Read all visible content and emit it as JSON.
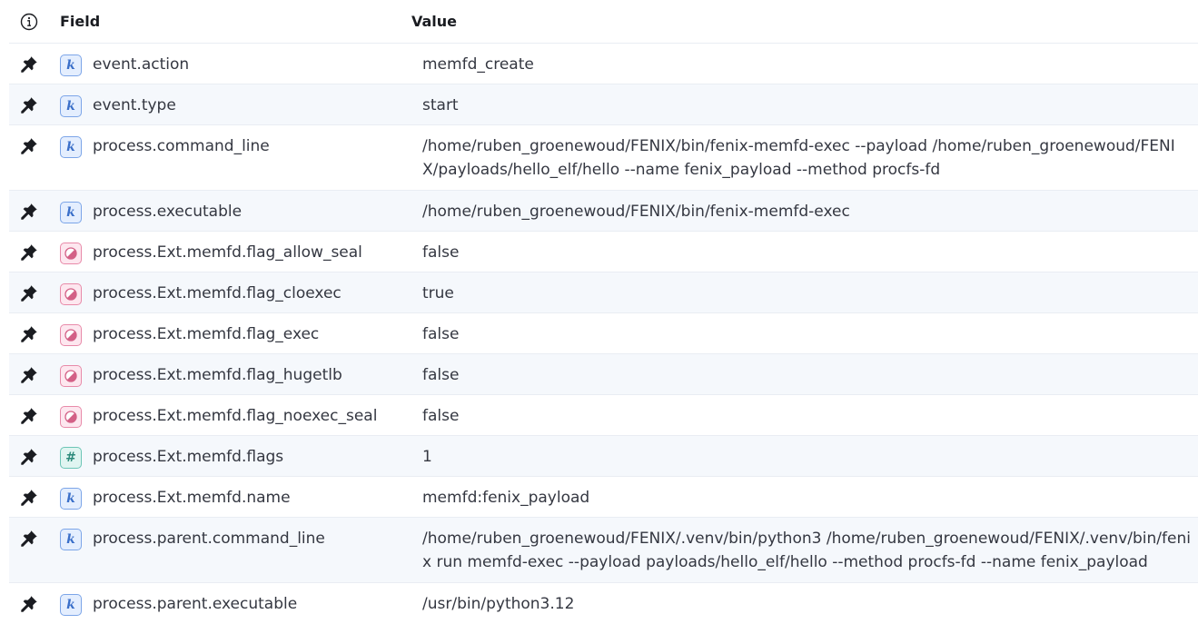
{
  "header": {
    "field_label": "Field",
    "value_label": "Value"
  },
  "icons": {
    "info": "info-icon",
    "pin": "pin-icon",
    "keyword": "keyword-type-icon",
    "number": "number-type-icon",
    "boolean": "boolean-type-icon"
  },
  "colors": {
    "row_alt": "#f5f8fc",
    "border": "#e9edf3",
    "keyword": "#3a6fc9",
    "number": "#2b8a7a",
    "boolean": "#d36086"
  },
  "rows": [
    {
      "type": "keyword",
      "type_glyph": "k",
      "field": "event.action",
      "value": "memfd_create"
    },
    {
      "type": "keyword",
      "type_glyph": "k",
      "field": "event.type",
      "value": "start"
    },
    {
      "type": "keyword",
      "type_glyph": "k",
      "field": "process.command_line",
      "value": "/home/ruben_groenewoud/FENIX/bin/fenix-memfd-exec --payload /home/ruben_groenewoud/FENIX/payloads/hello_elf/hello --name fenix_payload --method procfs-fd"
    },
    {
      "type": "keyword",
      "type_glyph": "k",
      "field": "process.executable",
      "value": "/home/ruben_groenewoud/FENIX/bin/fenix-memfd-exec"
    },
    {
      "type": "boolean",
      "type_glyph": "",
      "field": "process.Ext.memfd.flag_allow_seal",
      "value": "false"
    },
    {
      "type": "boolean",
      "type_glyph": "",
      "field": "process.Ext.memfd.flag_cloexec",
      "value": "true"
    },
    {
      "type": "boolean",
      "type_glyph": "",
      "field": "process.Ext.memfd.flag_exec",
      "value": "false"
    },
    {
      "type": "boolean",
      "type_glyph": "",
      "field": "process.Ext.memfd.flag_hugetlb",
      "value": "false"
    },
    {
      "type": "boolean",
      "type_glyph": "",
      "field": "process.Ext.memfd.flag_noexec_seal",
      "value": "false"
    },
    {
      "type": "number",
      "type_glyph": "#",
      "field": "process.Ext.memfd.flags",
      "value": "1"
    },
    {
      "type": "keyword",
      "type_glyph": "k",
      "field": "process.Ext.memfd.name",
      "value": "memfd:fenix_payload"
    },
    {
      "type": "keyword",
      "type_glyph": "k",
      "field": "process.parent.command_line",
      "value": "/home/ruben_groenewoud/FENIX/.venv/bin/python3 /home/ruben_groenewoud/FENIX/.venv/bin/fenix run memfd-exec --payload payloads/hello_elf/hello --method procfs-fd --name fenix_payload"
    },
    {
      "type": "keyword",
      "type_glyph": "k",
      "field": "process.parent.executable",
      "value": "/usr/bin/python3.12"
    }
  ]
}
